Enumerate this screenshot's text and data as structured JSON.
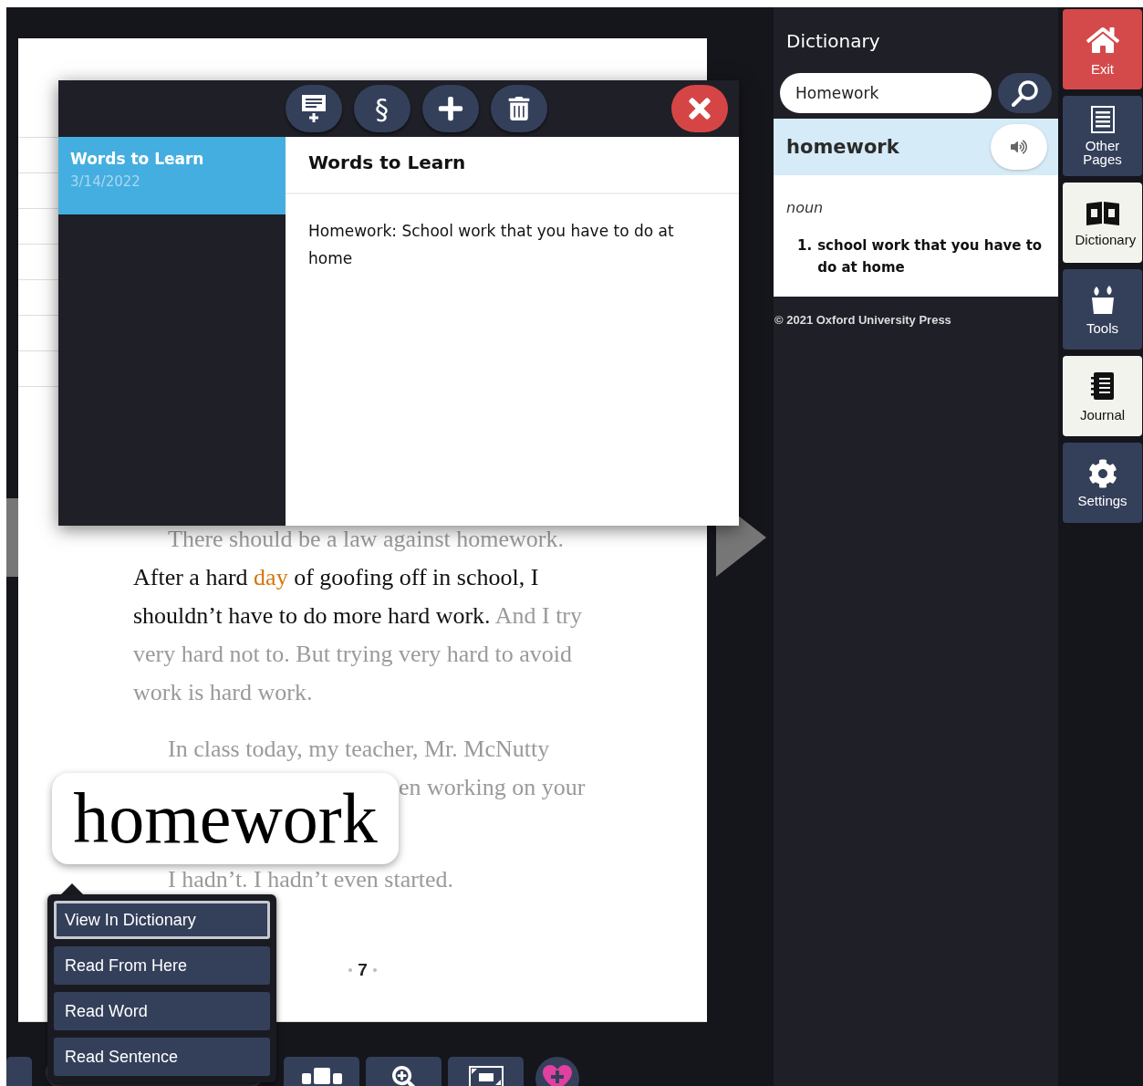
{
  "notebook": {
    "toolbar": [
      {
        "kind": "new-note"
      },
      {
        "kind": "section",
        "label": "§"
      },
      {
        "kind": "add"
      },
      {
        "kind": "delete"
      }
    ],
    "notes": [
      {
        "title": "Words to Learn",
        "date": "3/14/2022",
        "selected": true
      }
    ],
    "open_note": {
      "title": "Words to Learn",
      "body": "Homework: School work that you have to do at home"
    }
  },
  "book_page": {
    "lines": [
      {
        "kind": "indent",
        "segments": [
          {
            "text": "There should be a law against homework.",
            "kind": "unread"
          }
        ]
      },
      {
        "kind": "plain",
        "segments": [
          {
            "text": "After a hard ",
            "kind": "read"
          },
          {
            "text": "day",
            "kind": "current"
          },
          {
            "text": " of goofing off in school, I",
            "kind": "read"
          }
        ]
      },
      {
        "kind": "plain",
        "segments": [
          {
            "text": "shouldn’t have to do more hard work.",
            "kind": "read"
          },
          {
            "text": " And I try",
            "kind": "unread"
          }
        ]
      },
      {
        "kind": "plain",
        "segments": [
          {
            "text": "very hard not to. But trying very hard to avoid",
            "kind": "unread"
          }
        ]
      },
      {
        "kind": "plain",
        "segments": [
          {
            "text": "work is hard work.",
            "kind": "unread"
          }
        ]
      },
      {
        "kind": "break",
        "segments": [
          {
            "text": "In class today, my teacher, Mr. McNutty",
            "kind": "unread"
          }
        ]
      },
      {
        "kind": "tail",
        "segments": [
          {
            "text": "en working on your",
            "kind": "unread"
          }
        ]
      },
      {
        "kind": "break",
        "segments": [
          {
            "text": "I hadn’t. I hadn’t even started.",
            "kind": "unread"
          }
        ]
      }
    ],
    "page_number": "7"
  },
  "magnifier": {
    "word": "homework"
  },
  "context_menu": [
    {
      "label": "View In Dictionary",
      "selected": true
    },
    {
      "label": "Read From Here",
      "selected": false
    },
    {
      "label": "Read Word",
      "selected": false
    },
    {
      "label": "Read Sentence",
      "selected": false
    }
  ],
  "dictionary": {
    "title": "Dictionary",
    "search_value": "Homework",
    "headword": "homework",
    "part_of_speech": "noun",
    "definitions": [
      {
        "number": "1.",
        "text": "school work that you have to do at home"
      }
    ],
    "copyright": "© 2021 Oxford University Press"
  },
  "nav": [
    {
      "kind": "exit",
      "label": "Exit",
      "selected": false
    },
    {
      "kind": "pages",
      "label": "Other Pages",
      "selected": false
    },
    {
      "kind": "dictionary",
      "label": "Dictionary",
      "selected": true
    },
    {
      "kind": "tools",
      "label": "Tools",
      "selected": false
    },
    {
      "kind": "journal",
      "label": "Journal",
      "selected": true
    },
    {
      "kind": "settings",
      "label": "Settings",
      "selected": false
    }
  ]
}
